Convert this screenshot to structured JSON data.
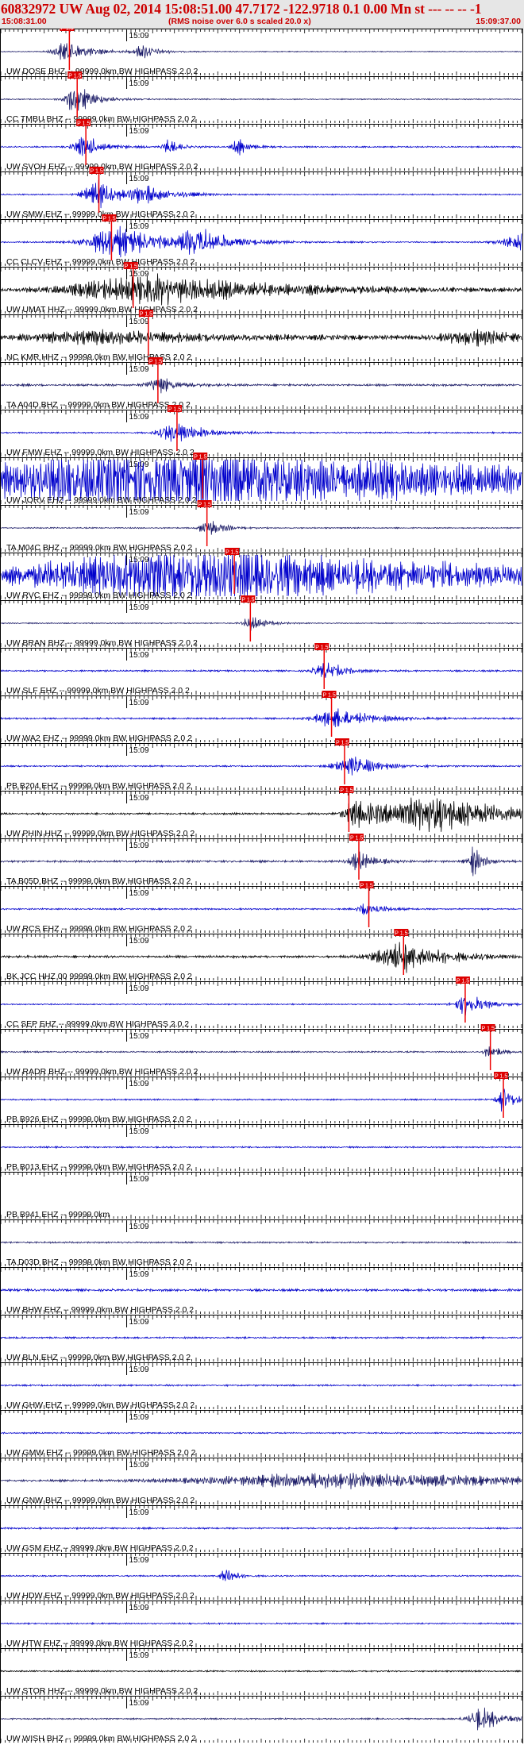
{
  "header": {
    "title": "60832972 UW Aug 02, 2014 15:08:51.00   47.7172 -122.9718  0.1 0.00 Mn st --- -- --   -1",
    "start_time": "15:08:31.00",
    "end_time": "15:09:37.00",
    "note": "(RMS noise over 6.0 s scaled 20.0 x)"
  },
  "colors": {
    "background": "#ffffff",
    "header_bg": "#e6e6e6",
    "header_text": "#cc0000",
    "pick": "#ee0000",
    "pick_label_bg": "#dd0000"
  },
  "chart_data": {
    "type": "seismogram",
    "minute_label": "15:09",
    "pick_label": "P 1.5",
    "traces": [
      {
        "label": "UW DOSE BHZ -- 99999.0km BW  HIGHPASS  2.0  2",
        "pick": 15.8,
        "color": "#1a1a66",
        "amp": 0.18,
        "events": [
          [
            15.8,
            5,
            2.2
          ],
          [
            33,
            3,
            1.4
          ]
        ]
      },
      {
        "label": "CC TMBU BHZ -- 99999.0km BW  HIGHPASS  2.0  2",
        "pick": 17.6,
        "color": "#1a1a66",
        "amp": 0.22,
        "events": [
          [
            17.6,
            4,
            2.8
          ]
        ]
      },
      {
        "label": "UW SVOH EHZ -- 99999.0km BW  HIGHPASS  2.0  2",
        "pick": 19.6,
        "color": "#0000cc",
        "amp": 0.3,
        "events": [
          [
            19.6,
            4,
            2.0
          ],
          [
            39,
            2,
            1.6
          ],
          [
            55,
            2,
            1.6
          ]
        ]
      },
      {
        "label": "UW SMW EHZ -- 99999.0km BW  HIGHPASS  2.0  2",
        "pick": 22.6,
        "color": "#0000cc",
        "amp": 0.25,
        "events": [
          [
            22.6,
            5,
            2.6
          ],
          [
            34,
            6,
            1.6
          ]
        ]
      },
      {
        "label": "CC CLCV EHZ -- 99999.0km BW  HIGHPASS  2.0  2",
        "pick": 25.5,
        "color": "#0000cc",
        "amp": 0.3,
        "events": [
          [
            27,
            10,
            3.2
          ],
          [
            46,
            6,
            2.6
          ],
          [
            124,
            10,
            3.0
          ]
        ]
      },
      {
        "label": "UW UMAT HHZ -- 99999.0km BW  HIGHPASS  2.0  2",
        "pick": 30.5,
        "color": "#000000",
        "amp": 0.6,
        "events": [
          [
            36,
            30,
            2.6
          ]
        ]
      },
      {
        "label": "NC KMR HHZ -- 99999.0km BW  HIGHPASS  2.0  2",
        "pick": 34.0,
        "color": "#000000",
        "amp": 0.7,
        "events": [
          [
            26,
            30,
            1.2
          ],
          [
            110,
            12,
            1.3
          ]
        ]
      },
      {
        "label": "TA A04D BHZ -- 99999.0km BW  HIGHPASS  2.0  2",
        "pick": 36.2,
        "color": "#1a1a66",
        "amp": 0.45,
        "events": [
          [
            36.5,
            4,
            1.6
          ]
        ]
      },
      {
        "label": "UW FMW EHZ -- 99999.0km BW  HIGHPASS  2.0  2",
        "pick": 40.6,
        "color": "#0000cc",
        "amp": 0.3,
        "events": [
          [
            40.6,
            6,
            2.0
          ]
        ]
      },
      {
        "label": "UW JORV EHZ -- 99999.0km BW  HIGHPASS  2.0  2",
        "pick": 46.5,
        "color": "#0000cc",
        "amp": 0.5,
        "events": [
          [
            45,
            90,
            6.0
          ]
        ]
      },
      {
        "label": "TA M04C BHZ -- 99999.0km BW  HIGHPASS  2.0  2",
        "pick": 47.5,
        "color": "#1a1a66",
        "amp": 0.25,
        "events": [
          [
            48,
            3,
            1.8
          ]
        ]
      },
      {
        "label": "UW RVC EHZ -- 99999.0km BW  HIGHPASS  2.0  2",
        "pick": 53.8,
        "color": "#0000cc",
        "amp": 0.5,
        "events": [
          [
            49,
            66,
            5.5
          ]
        ]
      },
      {
        "label": "UW BRAN BHZ -- 99999.0km BW  HIGHPASS  2.0  2",
        "pick": 57.5,
        "color": "#1a1a66",
        "amp": 0.22,
        "events": [
          [
            58,
            3,
            1.4
          ]
        ]
      },
      {
        "label": "UW SLF EHZ -- 99999.0km BW  HIGHPASS  2.0  2",
        "pick": 74.5,
        "color": "#0000cc",
        "amp": 0.35,
        "events": [
          [
            75,
            4,
            1.8
          ]
        ]
      },
      {
        "label": "UW WA2 EHZ -- 99999.0km BW  HIGHPASS  2.0  2",
        "pick": 76.2,
        "color": "#0000cc",
        "amp": 0.35,
        "events": [
          [
            78,
            8,
            1.8
          ]
        ]
      },
      {
        "label": "PB B204 EHZ -- 99999.0km BW  HIGHPASS  2.0  2",
        "pick": 79.2,
        "color": "#0000cc",
        "amp": 0.3,
        "events": [
          [
            81,
            6,
            2.0
          ]
        ]
      },
      {
        "label": "UW PHIN HHZ -- 99999.0km BW  HIGHPASS  2.0  2",
        "pick": 80.2,
        "color": "#000000",
        "amp": 0.4,
        "events": [
          [
            82,
            4,
            2.6
          ],
          [
            100,
            18,
            3.6
          ]
        ]
      },
      {
        "label": "TA B05D BHZ -- 99999.0km BW  HIGHPASS  2.0  2",
        "pick": 82.5,
        "color": "#1a1a66",
        "amp": 0.45,
        "events": [
          [
            82.5,
            3,
            1.8
          ],
          [
            109,
            2,
            2.6
          ]
        ]
      },
      {
        "label": "UW RCS EHZ -- 99999.0km BW  HIGHPASS  2.0  2",
        "pick": 84.8,
        "color": "#0000cc",
        "amp": 0.3,
        "events": [
          [
            84.8,
            3,
            1.6
          ]
        ]
      },
      {
        "label": "BK JCC HHZ 00 99999.0km BW  HIGHPASS  2.0  2",
        "pick": 92.8,
        "color": "#000000",
        "amp": 0.5,
        "events": [
          [
            93,
            10,
            2.8
          ]
        ]
      },
      {
        "label": "CC SEP EHZ -- 99999.0km BW  HIGHPASS  2.0  2",
        "pick": 107.0,
        "color": "#0000cc",
        "amp": 0.25,
        "events": [
          [
            107.5,
            4,
            2.2
          ]
        ]
      },
      {
        "label": "UW RADR BHZ -- 99999.0km BW  HIGHPASS  2.0  2",
        "pick": 112.8,
        "color": "#1a1a66",
        "amp": 0.3,
        "events": [
          [
            113,
            2,
            1.4
          ]
        ]
      },
      {
        "label": "PB B926 EHZ -- 99999.0km BW  HIGHPASS  2.0  2",
        "pick": 115.8,
        "color": "#0000cc",
        "amp": 0.3,
        "events": [
          [
            116,
            2,
            3.0
          ]
        ]
      },
      {
        "label": "PB B013 EHZ -- 99999.0km BW  HIGHPASS  2.0  2",
        "pick": null,
        "color": "#0000cc",
        "amp": 0.3,
        "events": []
      },
      {
        "label": "PB B941 EHZ -- 99999.0km",
        "pick": null,
        "color": "#0000cc",
        "amp": 0,
        "events": []
      },
      {
        "label": "TA D03D BHZ -- 99999.0km BW  HIGHPASS  2.0  2",
        "pick": null,
        "color": "#1a1a66",
        "amp": 0.35,
        "events": []
      },
      {
        "label": "UW BHW EHZ -- 99999.0km BW  HIGHPASS  2.0  2",
        "pick": null,
        "color": "#0000cc",
        "amp": 0.5,
        "events": []
      },
      {
        "label": "UW BLN EHZ -- 99999.0km BW  HIGHPASS  2.0  2",
        "pick": null,
        "color": "#0000cc",
        "amp": 0.35,
        "events": []
      },
      {
        "label": "UW GHW EHZ -- 99999.0km BW  HIGHPASS  2.0  2",
        "pick": null,
        "color": "#0000cc",
        "amp": 0.35,
        "events": []
      },
      {
        "label": "UW GMW EHZ -- 99999.0km BW  HIGHPASS  2.0  2",
        "pick": null,
        "color": "#0000cc",
        "amp": 0.3,
        "events": []
      },
      {
        "label": "UW GNW BHZ -- 99999.0km BW  HIGHPASS  2.0  2",
        "pick": null,
        "color": "#1a1a66",
        "amp": 0.4,
        "events": [
          [
            80,
            50,
            1.4
          ]
        ]
      },
      {
        "label": "UW GSM EHZ -- 99999.0km BW  HIGHPASS  2.0  2",
        "pick": null,
        "color": "#0000cc",
        "amp": 0.35,
        "events": []
      },
      {
        "label": "UW HDW EHZ -- 99999.0km BW  HIGHPASS  2.0  2",
        "pick": null,
        "color": "#0000cc",
        "amp": 0.3,
        "events": [
          [
            52,
            2,
            1.8
          ]
        ]
      },
      {
        "label": "UW HTW EHZ -- 99999.0km BW  HIGHPASS  2.0  2",
        "pick": null,
        "color": "#0000cc",
        "amp": 0.3,
        "events": []
      },
      {
        "label": "UW STOR HHZ -- 99999.0km BW  HIGHPASS  2.0  2",
        "pick": null,
        "color": "#000000",
        "amp": 0.3,
        "events": []
      },
      {
        "label": "UW WISH BHZ -- 99999.0km BW  HIGHPASS  2.0  2",
        "pick": null,
        "color": "#1a1a66",
        "amp": 0.3,
        "events": [
          [
            111,
            5,
            2.2
          ]
        ]
      }
    ]
  }
}
